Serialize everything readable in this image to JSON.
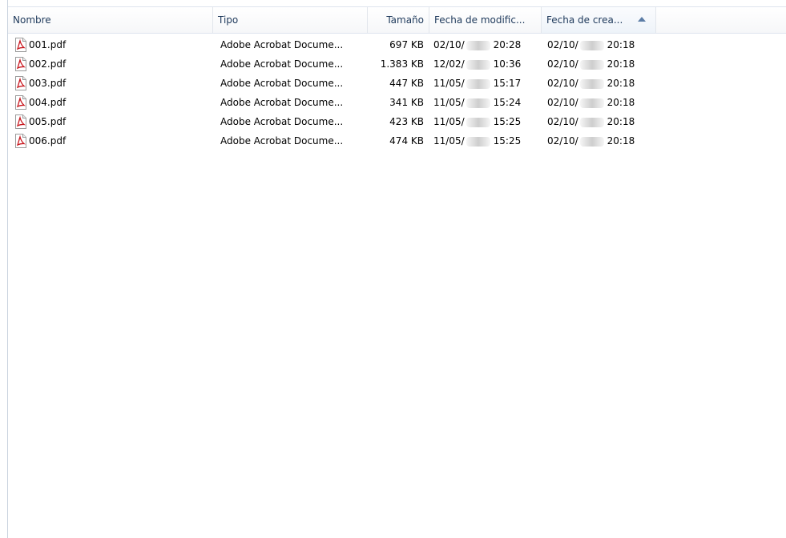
{
  "columns": {
    "name": "Nombre",
    "type": "Tipo",
    "size": "Tamaño",
    "modified": "Fecha de modific...",
    "created": "Fecha de crea..."
  },
  "sort": {
    "column": "created",
    "direction": "ascending",
    "icon": "sort-ascending-icon"
  },
  "files": [
    {
      "name": "001.pdf",
      "type": "Adobe Acrobat Docume...",
      "size": "697 KB",
      "modified_date": "02/10/",
      "modified_time": "20:28",
      "created_date": "02/10/",
      "created_time": "20:18",
      "icon": "pdf-file-icon"
    },
    {
      "name": "002.pdf",
      "type": "Adobe Acrobat Docume...",
      "size": "1.383 KB",
      "modified_date": "12/02/",
      "modified_time": "10:36",
      "created_date": "02/10/",
      "created_time": "20:18",
      "icon": "pdf-file-icon"
    },
    {
      "name": "003.pdf",
      "type": "Adobe Acrobat Docume...",
      "size": "447 KB",
      "modified_date": "11/05/",
      "modified_time": "15:17",
      "created_date": "02/10/",
      "created_time": "20:18",
      "icon": "pdf-file-icon"
    },
    {
      "name": "004.pdf",
      "type": "Adobe Acrobat Docume...",
      "size": "341 KB",
      "modified_date": "11/05/",
      "modified_time": "15:24",
      "created_date": "02/10/",
      "created_time": "20:18",
      "icon": "pdf-file-icon"
    },
    {
      "name": "005.pdf",
      "type": "Adobe Acrobat Docume...",
      "size": "423 KB",
      "modified_date": "11/05/",
      "modified_time": "15:25",
      "created_date": "02/10/",
      "created_time": "20:18",
      "icon": "pdf-file-icon"
    },
    {
      "name": "006.pdf",
      "type": "Adobe Acrobat Docume...",
      "size": "474 KB",
      "modified_date": "11/05/",
      "modified_time": "15:25",
      "created_date": "02/10/",
      "created_time": "20:18",
      "icon": "pdf-file-icon"
    }
  ],
  "colors": {
    "header_text": "#1e395b",
    "pdf_red": "#c8171e",
    "border": "#dde4ee"
  }
}
